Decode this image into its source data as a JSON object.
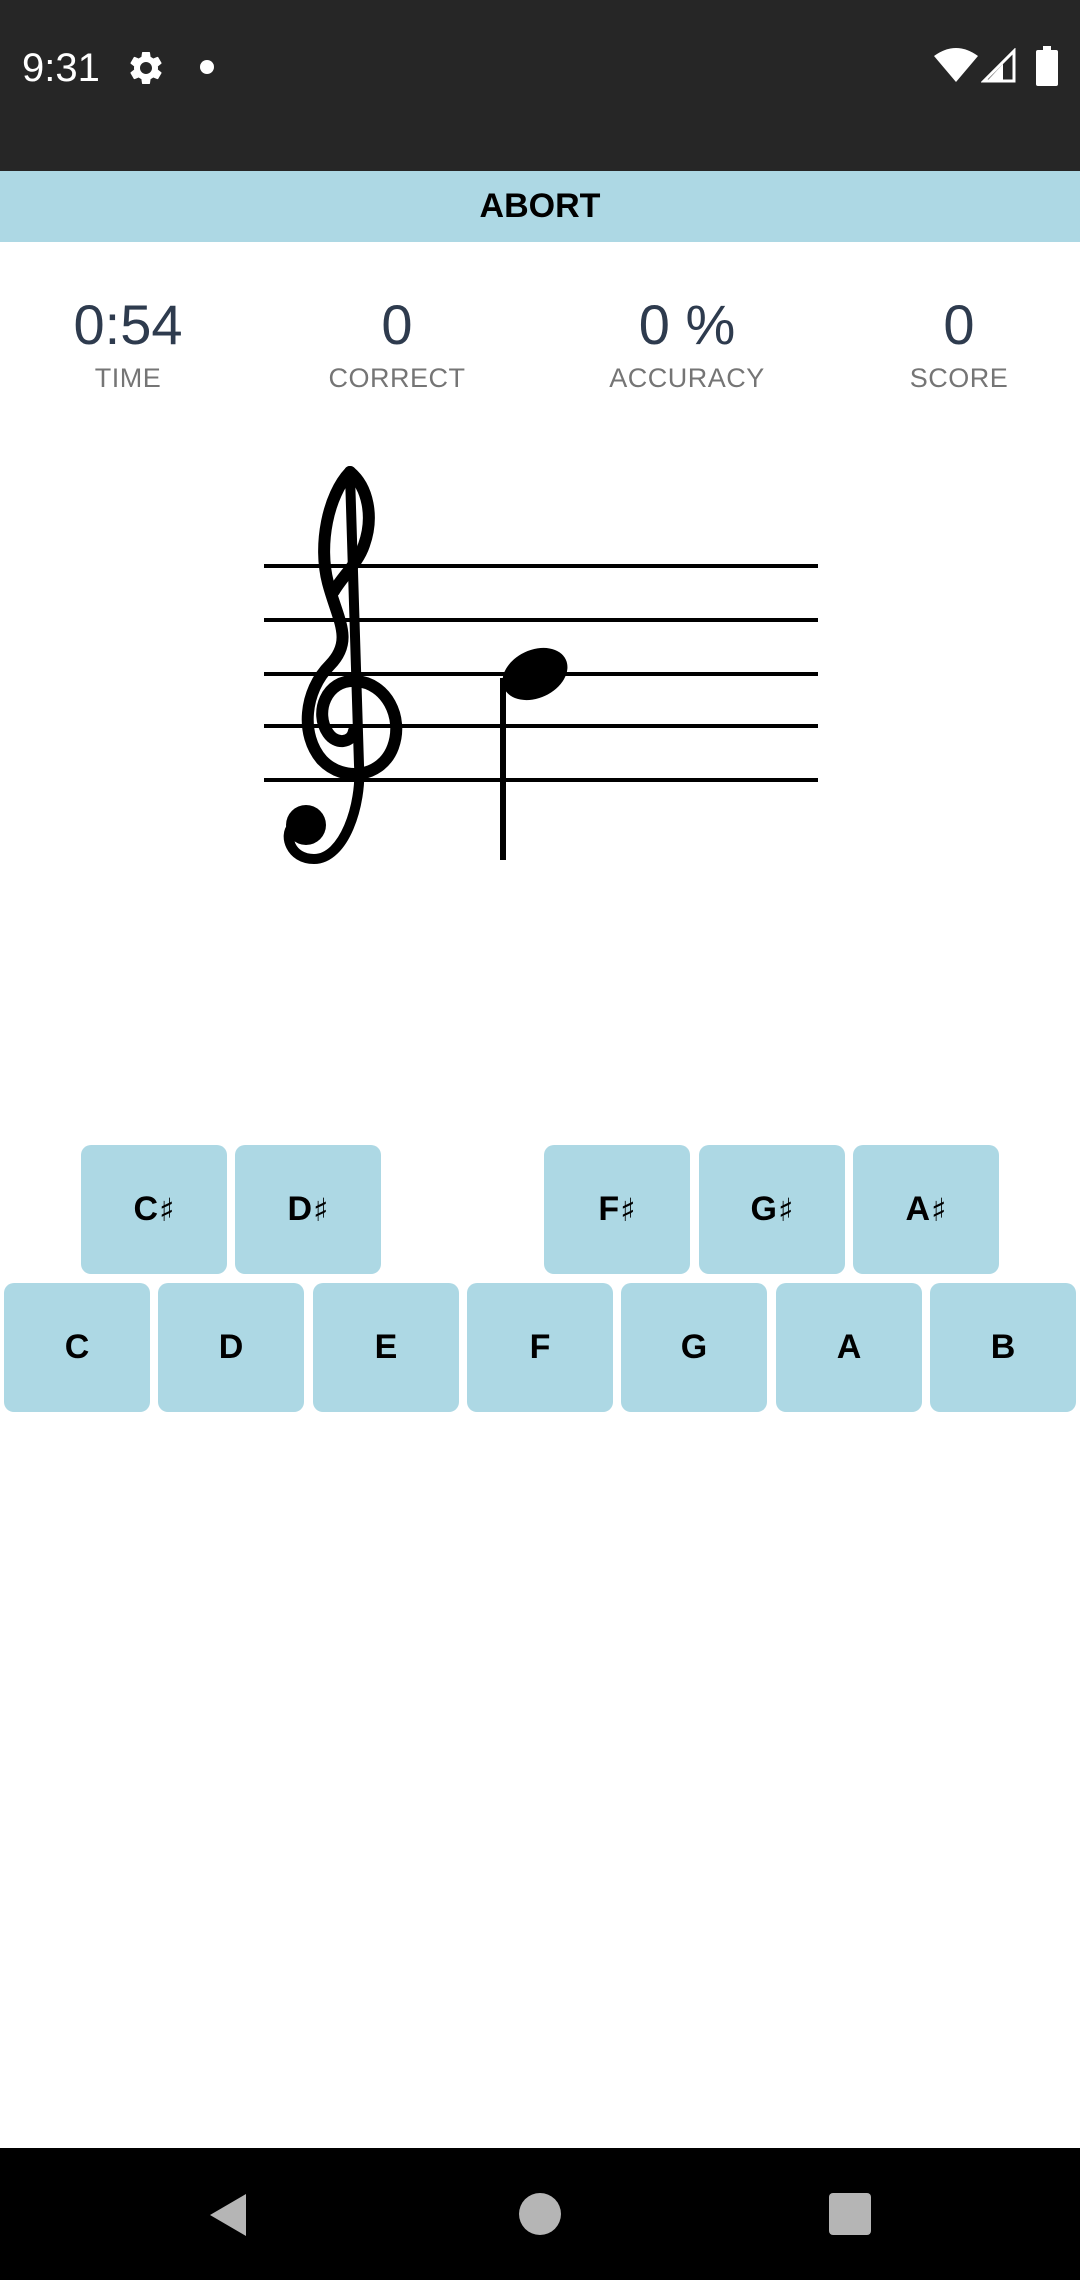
{
  "status_bar": {
    "time": "9:31",
    "icons": [
      "gear-icon",
      "notification-dot-icon",
      "wifi-icon",
      "signal-icon",
      "battery-icon"
    ]
  },
  "abort_button": {
    "label": "ABORT"
  },
  "stats": {
    "time": {
      "value": "0:54",
      "label": "TIME"
    },
    "correct": {
      "value": "0",
      "label": "CORRECT"
    },
    "accuracy": {
      "value": "0 %",
      "label": "ACCURACY"
    },
    "score": {
      "value": "0",
      "label": "SCORE"
    }
  },
  "staff": {
    "clef": "treble-clef-icon",
    "note": "quarter-note-icon"
  },
  "keyboard": {
    "sharps": [
      {
        "letter": "C",
        "accidental": "♯"
      },
      {
        "letter": "D",
        "accidental": "♯"
      },
      {
        "letter": "F",
        "accidental": "♯"
      },
      {
        "letter": "G",
        "accidental": "♯"
      },
      {
        "letter": "A",
        "accidental": "♯"
      }
    ],
    "naturals": [
      "C",
      "D",
      "E",
      "F",
      "G",
      "A",
      "B"
    ]
  },
  "colors": {
    "accent": "#add8e4",
    "status_bar": "#262626",
    "nav_bar": "#000000",
    "stat_value": "#2e3b4e",
    "stat_label": "#757575"
  },
  "nav_bar": {
    "icons": [
      "back-icon",
      "home-icon",
      "recents-icon"
    ]
  }
}
